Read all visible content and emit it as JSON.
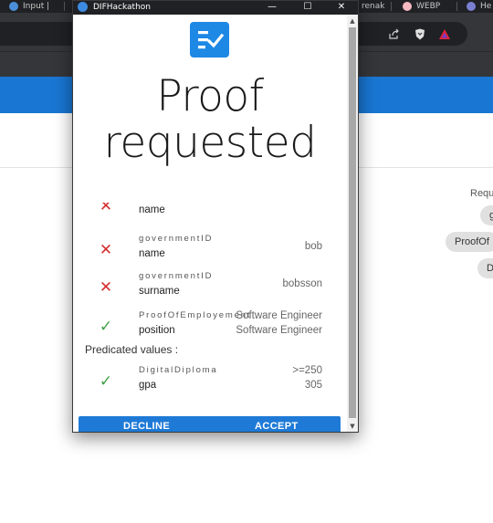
{
  "browser": {
    "tabs": [
      {
        "label": "Input |",
        "icon": "app-icon"
      },
      {
        "label": "renak",
        "icon": "none"
      },
      {
        "label": "WEBP",
        "icon": "pig-icon"
      },
      {
        "label": "He",
        "icon": "ai-icon"
      }
    ]
  },
  "background": {
    "right_label": "Requ",
    "chips": [
      "g",
      "ProofOf",
      "D"
    ]
  },
  "popup": {
    "window_title": "DIFHackathon",
    "window_icon": "app-icon",
    "minimize_glyph": "—",
    "maximize_glyph": "☐",
    "close_glyph": "✕",
    "title": "Proof requested",
    "title_lines": [
      "Proof",
      "requested"
    ],
    "rows": [
      {
        "status": "missing",
        "credential": "",
        "attribute": "name",
        "value1": "",
        "value2": "",
        "partial": true
      },
      {
        "status": "missing",
        "credential": "governmentID",
        "attribute": "name",
        "value1": "bob",
        "value2": ""
      },
      {
        "status": "missing",
        "credential": "governmentID",
        "attribute": "surname",
        "value1": "bobsson",
        "value2": ""
      },
      {
        "status": "ok",
        "credential": "ProofOfEmployement",
        "attribute": "position",
        "value1": "Software Engineer",
        "value2": "Software Engineer"
      }
    ],
    "predicated_label": "Predicated values :",
    "predicates": [
      {
        "status": "ok",
        "credential": "DigitalDiploma",
        "attribute": "gpa",
        "value1": ">=250",
        "value2": "305"
      }
    ],
    "decline_label": "DECLINE",
    "accept_label": "ACCEPT",
    "colors": {
      "primary": "#1e7ad6",
      "error": "#d32f2f",
      "success": "#43a047"
    }
  }
}
